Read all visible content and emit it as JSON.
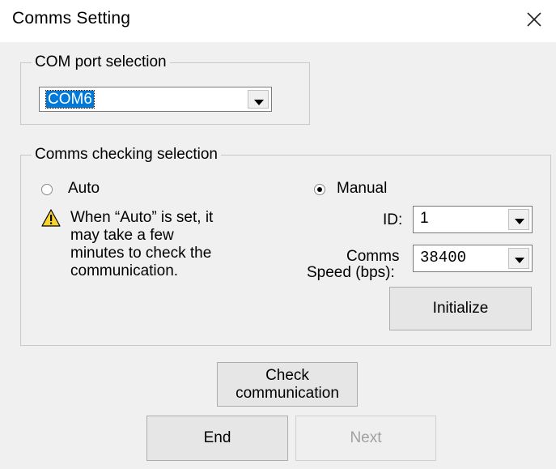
{
  "window": {
    "title": "Comms Setting"
  },
  "com_port": {
    "legend": "COM port selection",
    "selected": "COM6"
  },
  "comms_check": {
    "legend": "Comms checking selection",
    "auto": {
      "label": "Auto",
      "selected": false
    },
    "manual": {
      "label": "Manual",
      "selected": true
    },
    "warning_lines": [
      "When “Auto” is set, it",
      "may take a few",
      "minutes to check the",
      "communication."
    ],
    "id": {
      "label": "ID:",
      "value": "1"
    },
    "speed": {
      "label_line1": "Comms",
      "label_line2": "Speed (bps):",
      "value": "38400"
    },
    "initialize_label": "Initialize"
  },
  "buttons": {
    "check_line1": "Check",
    "check_line2": "communication",
    "end": "End",
    "next": "Next"
  },
  "colors": {
    "selection_highlight": "#0078d7",
    "warning_yellow": "#f6d32d"
  }
}
